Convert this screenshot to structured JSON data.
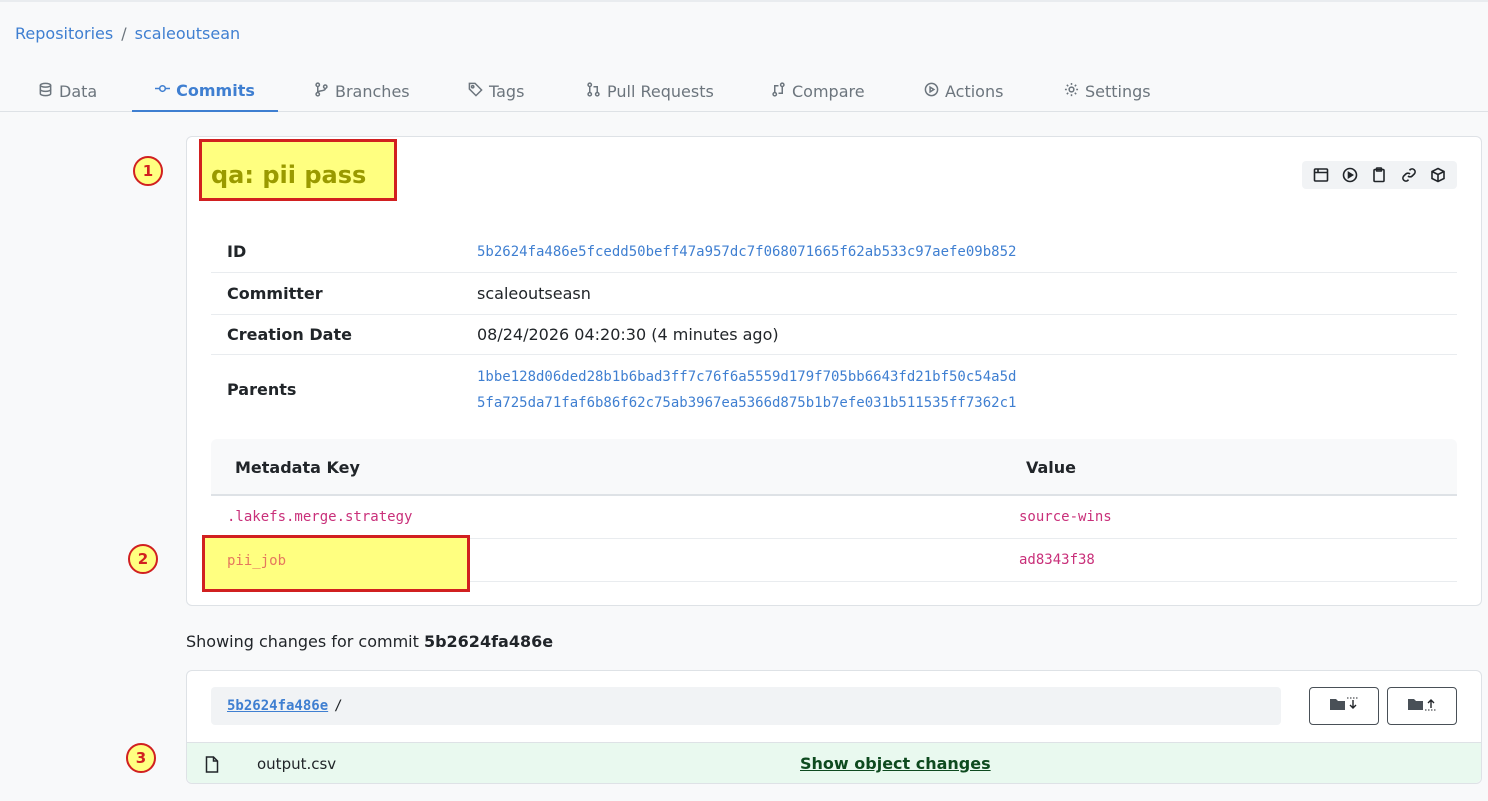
{
  "breadcrumb": {
    "items": [
      "Repositories",
      "scaleoutsean"
    ],
    "separator": "/"
  },
  "tabs": [
    {
      "label": "Data",
      "icon": "database-icon"
    },
    {
      "label": "Commits",
      "icon": "commit-icon",
      "active": true
    },
    {
      "label": "Branches",
      "icon": "branch-icon"
    },
    {
      "label": "Tags",
      "icon": "tag-icon"
    },
    {
      "label": "Pull Requests",
      "icon": "pull-request-icon"
    },
    {
      "label": "Compare",
      "icon": "compare-icon"
    },
    {
      "label": "Actions",
      "icon": "play-circle-icon"
    },
    {
      "label": "Settings",
      "icon": "gear-icon"
    }
  ],
  "commit": {
    "title": "qa: pii pass",
    "toolbar_icons": [
      "browse-icon",
      "run-icon",
      "clipboard-icon",
      "link-icon",
      "package-icon"
    ],
    "info": {
      "id_label": "ID",
      "id_value": "5b2624fa486e5fcedd50beff47a957dc7f068071665f62ab533c97aefe09b852",
      "committer_label": "Committer",
      "committer_value": "scaleoutseasn",
      "date_label": "Creation Date",
      "date_value": "08/24/2026 04:20:30 (4 minutes ago)",
      "parents_label": "Parents",
      "parents": [
        "1bbe128d06ded28b1b6bad3ff7c76f6a5559d179f705bb6643fd21bf50c54a5d",
        "5fa725da71faf6b86f62c75ab3967ea5366d875b1b7efe031b511535ff7362c1"
      ]
    },
    "metadata": {
      "key_header": "Metadata Key",
      "value_header": "Value",
      "rows": [
        {
          "key": ".lakefs.merge.strategy",
          "value": "source-wins"
        },
        {
          "key": "pii_job",
          "value": "ad8343f38"
        }
      ]
    }
  },
  "changes": {
    "prefix": "Showing changes for commit ",
    "commit_short": "5b2624fa486e",
    "path_link": "5b2624fa486e",
    "path_sep": "/",
    "files": [
      {
        "name": "output.csv",
        "action": "Show object changes"
      }
    ]
  },
  "annotations": [
    "1",
    "2",
    "3"
  ],
  "colors": {
    "accent": "#3f7fd1",
    "highlight": "#ffff80",
    "marker_border": "#d12020",
    "metadata_text": "#c9307a",
    "added_row": "#e9f9ef"
  }
}
